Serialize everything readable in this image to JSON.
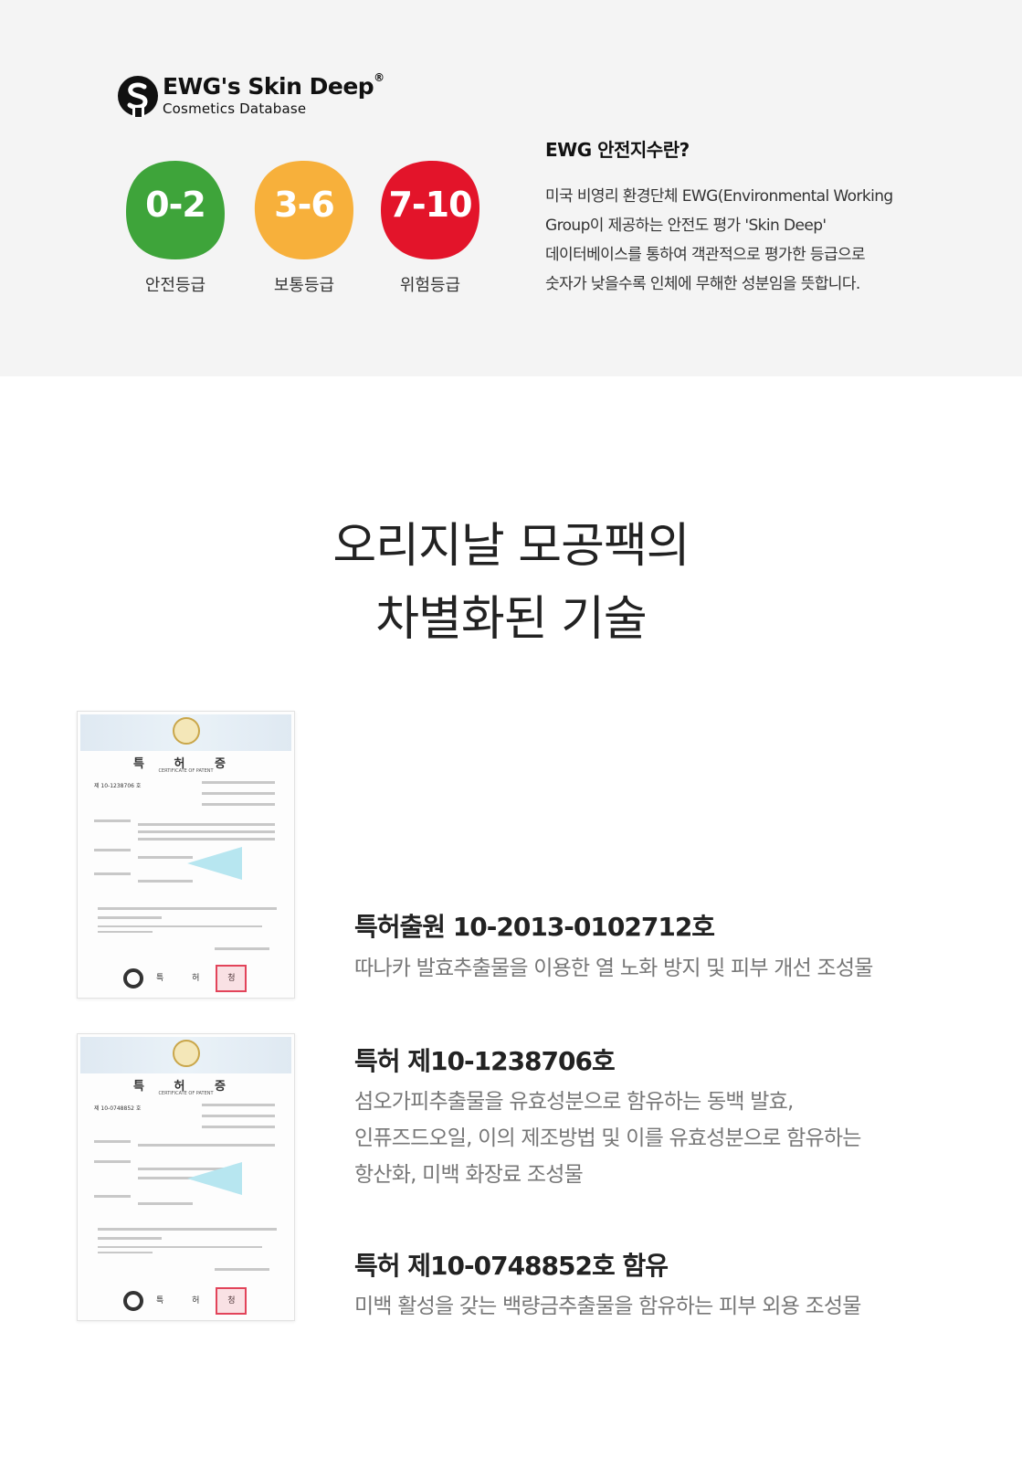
{
  "ewg": {
    "logo_title": "EWG's Skin Deep",
    "logo_registered": "®",
    "logo_subtitle": "Cosmetics Database",
    "grades": [
      {
        "range": "0-2",
        "label": "안전등급",
        "color": "#3ea43a"
      },
      {
        "range": "3-6",
        "label": "보통등급",
        "color": "#f7b03b"
      },
      {
        "range": "7-10",
        "label": "위험등급",
        "color": "#e3142a"
      }
    ],
    "info_title": "EWG 안전지수란?",
    "info_lines": [
      "미국 비영리 환경단체  EWG(Environmental Working",
      "Group이 제공하는 안전도 평가 'Skin Deep'",
      "데이터베이스를 통하여 객관적으로 평가한 등급으로",
      "숫자가 낮을수록 인체에 무해한 성분임을 뜻합니다."
    ]
  },
  "headline": {
    "line1": "오리지날 모공팩의",
    "line2": "차별화된 기술"
  },
  "patents": [
    {
      "title": "특허출원 10-2013-0102712호",
      "desc": [
        "따나카 발효추출물을 이용한 열 노화 방지 및 피부 개선 조성물"
      ]
    },
    {
      "title": "특허 제10-1238706호",
      "desc": [
        "섬오가피추출물을 유효성분으로 함유하는 동백 발효,",
        "인퓨즈드오일, 이의 제조방법 및 이를 유효성분으로 함유하는",
        "항산화, 미백 화장료 조성물"
      ]
    },
    {
      "title": "특허 제10-0748852호 함유",
      "desc": [
        "미백 활성을 갖는 백량금추출물을 함유하는 피부 외용 조성물"
      ]
    }
  ],
  "certificates": [
    {
      "title": "특 허 증",
      "subtitle": "CERTIFICATE OF PATENT",
      "number": "제 10-1238706 호",
      "footer": "특 허 청"
    },
    {
      "title": "특 허 증",
      "subtitle": "CERTIFICATE OF PATENT",
      "number": "제 10-0748852 호",
      "footer": "특 허 청"
    }
  ]
}
